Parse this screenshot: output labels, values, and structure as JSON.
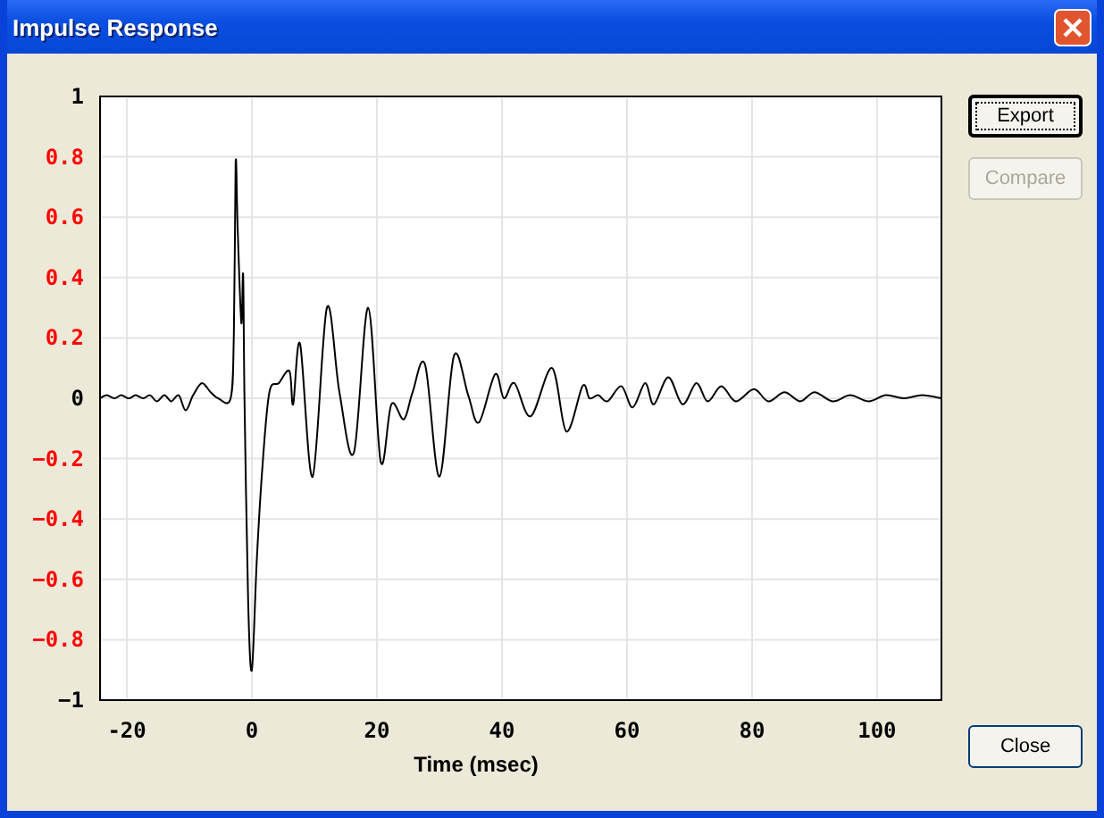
{
  "window": {
    "title": "Impulse Response"
  },
  "chart_data": {
    "type": "line",
    "grid": true,
    "xlabel": "Time (msec)",
    "xlim": [
      -24.3,
      110.3
    ],
    "ylim": [
      -1,
      1
    ],
    "x": [
      -24.3,
      -23.2,
      -22.0,
      -20.9,
      -19.7,
      -18.6,
      -17.4,
      -16.3,
      -15.2,
      -14.0,
      -12.9,
      -11.7,
      -10.6,
      -9.4,
      -8.0,
      -6.6,
      -5.4,
      -3.4,
      -2.9,
      -2.6,
      -2.3,
      -1.7,
      -1.4,
      -1.2,
      -0.6,
      0.0,
      0.8,
      1.7,
      2.8,
      4.3,
      6.0,
      6.6,
      7.7,
      9.7,
      12.0,
      14.0,
      16.3,
      18.6,
      20.6,
      22.3,
      24.3,
      25.7,
      27.7,
      30.0,
      32.3,
      34.6,
      36.3,
      38.9,
      40.3,
      42.0,
      44.6,
      48.0,
      50.3,
      52.9,
      54.0,
      55.4,
      56.9,
      59.1,
      60.9,
      62.9,
      64.3,
      66.6,
      68.9,
      71.1,
      72.9,
      75.1,
      77.4,
      80.3,
      82.6,
      85.2,
      87.7,
      90.0,
      92.9,
      95.7,
      98.6,
      101.4,
      104.3,
      107.2,
      110.3
    ],
    "series": [
      {
        "color": "#000000",
        "values": [
          0,
          0.01,
          0,
          0.01,
          0,
          0.01,
          0,
          0.01,
          -0.01,
          0.01,
          -0.01,
          0.01,
          -0.04,
          0.01,
          0.05,
          0.02,
          0,
          0,
          0.21,
          0.78,
          0.57,
          0.25,
          0.41,
          0.02,
          -0.67,
          -0.9,
          -0.53,
          -0.22,
          0.02,
          0.05,
          0.09,
          -0.02,
          0.18,
          -0.26,
          0.3,
          0.02,
          -0.18,
          0.3,
          -0.21,
          -0.02,
          -0.07,
          0.02,
          0.11,
          -0.26,
          0.14,
          0.01,
          -0.08,
          0.08,
          0,
          0.05,
          -0.06,
          0.1,
          -0.11,
          0.04,
          0,
          0.01,
          -0.01,
          0.04,
          -0.03,
          0.05,
          -0.02,
          0.07,
          -0.02,
          0.05,
          -0.01,
          0.04,
          -0.01,
          0.03,
          -0.01,
          0.02,
          -0.01,
          0.02,
          -0.01,
          0.01,
          -0.01,
          0.01,
          0,
          0.01,
          0
        ]
      }
    ],
    "xticks": [
      -20,
      0,
      20,
      40,
      60,
      80,
      100
    ],
    "yticks": [
      {
        "value": 1,
        "label": "1"
      },
      {
        "value": 0.8,
        "label": "0.8"
      },
      {
        "value": 0.6,
        "label": "0.6"
      },
      {
        "value": 0.4,
        "label": "0.4"
      },
      {
        "value": 0.2,
        "label": "0.2"
      },
      {
        "value": 0,
        "label": "0"
      },
      {
        "value": -0.2,
        "label": "−0.2"
      },
      {
        "value": -0.4,
        "label": "−0.4"
      },
      {
        "value": -0.6,
        "label": "−0.6"
      },
      {
        "value": -0.8,
        "label": "−0.8"
      },
      {
        "value": -1,
        "label": "−1"
      }
    ]
  },
  "buttons": [
    {
      "label": "Export",
      "disabled": false,
      "focused": true
    },
    {
      "label": "Compare",
      "disabled": true,
      "focused": false
    }
  ],
  "close_button": {
    "label": "Close",
    "disabled": false,
    "focused": false
  }
}
